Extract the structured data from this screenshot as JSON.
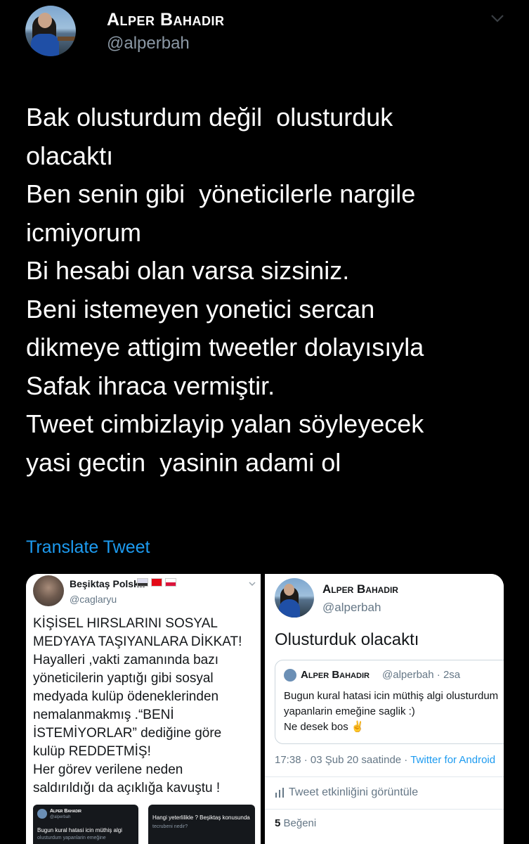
{
  "tweet": {
    "author": {
      "name": "Alper Bahadır",
      "handle": "@alperbah"
    },
    "lines": [
      "Bak olusturdum değil  olusturduk",
      "olacaktı",
      "Ben senin gibi  yöneticilerle nargile",
      "icmiyorum",
      "Bi hesabi olan varsa sizsiniz.",
      "Beni istemeyen yonetici sercan",
      "dikmeye attigim tweetler dolayısıyla",
      "Safak ihraca vermiştir.",
      "Tweet cimbizlayip yalan söyleyecek",
      "yasi gectin  yasinin adami ol"
    ],
    "translate_label": "Translate Tweet"
  },
  "media": {
    "left": {
      "name": "Beşiktaş Polska",
      "handle": "@caglaryu",
      "lines": [
        "KİŞİSEL HIRSLARINI SOSYAL",
        "MEDYAYA TAŞIYANLARA DİKKAT!",
        "Hayalleri ,vakti zamanında bazı",
        "yöneticilerin yaptığı gibi sosyal",
        "medyada kulüp ödeneklerinden",
        "nemalanmakmış .“BENİ",
        "İSTEMİYORLAR” dediğine göre",
        "kulüp REDDETMİŞ!",
        "Her görev verilene neden",
        "saldırıldığı da açıklığa kavuştu !"
      ],
      "thumb1": {
        "name": "Alper Bahadır",
        "handle": "@alperbah",
        "text": "Bugun kural hatasi icin müthiş algi",
        "text2": "olusturdum yapanlarin emeğine"
      },
      "thumb2": {
        "text": "Hangi yeterlilikle ? Beşiktaş konusunda",
        "text2": "tecrubeni nedir?"
      }
    },
    "right": {
      "name": "Alper Bahadır",
      "handle": "@alperbah",
      "text": "Olusturduk olacaktı",
      "quote": {
        "name": "Alper Bahadır",
        "meta": "@alperbah · 2sa",
        "lines": [
          "Bugun kural hatasi icin müthiş algi olusturdum",
          "yapanlarin emeğine saglik :)",
          "Ne desek bos ✌️"
        ]
      },
      "meta_time": "17:38 · 03 Şub 20 saatinde · ",
      "meta_client": "Twitter for Android",
      "activity_label": "Tweet etkinliğini görüntüle",
      "likes_count": "5",
      "likes_label": " Beğeni"
    }
  }
}
